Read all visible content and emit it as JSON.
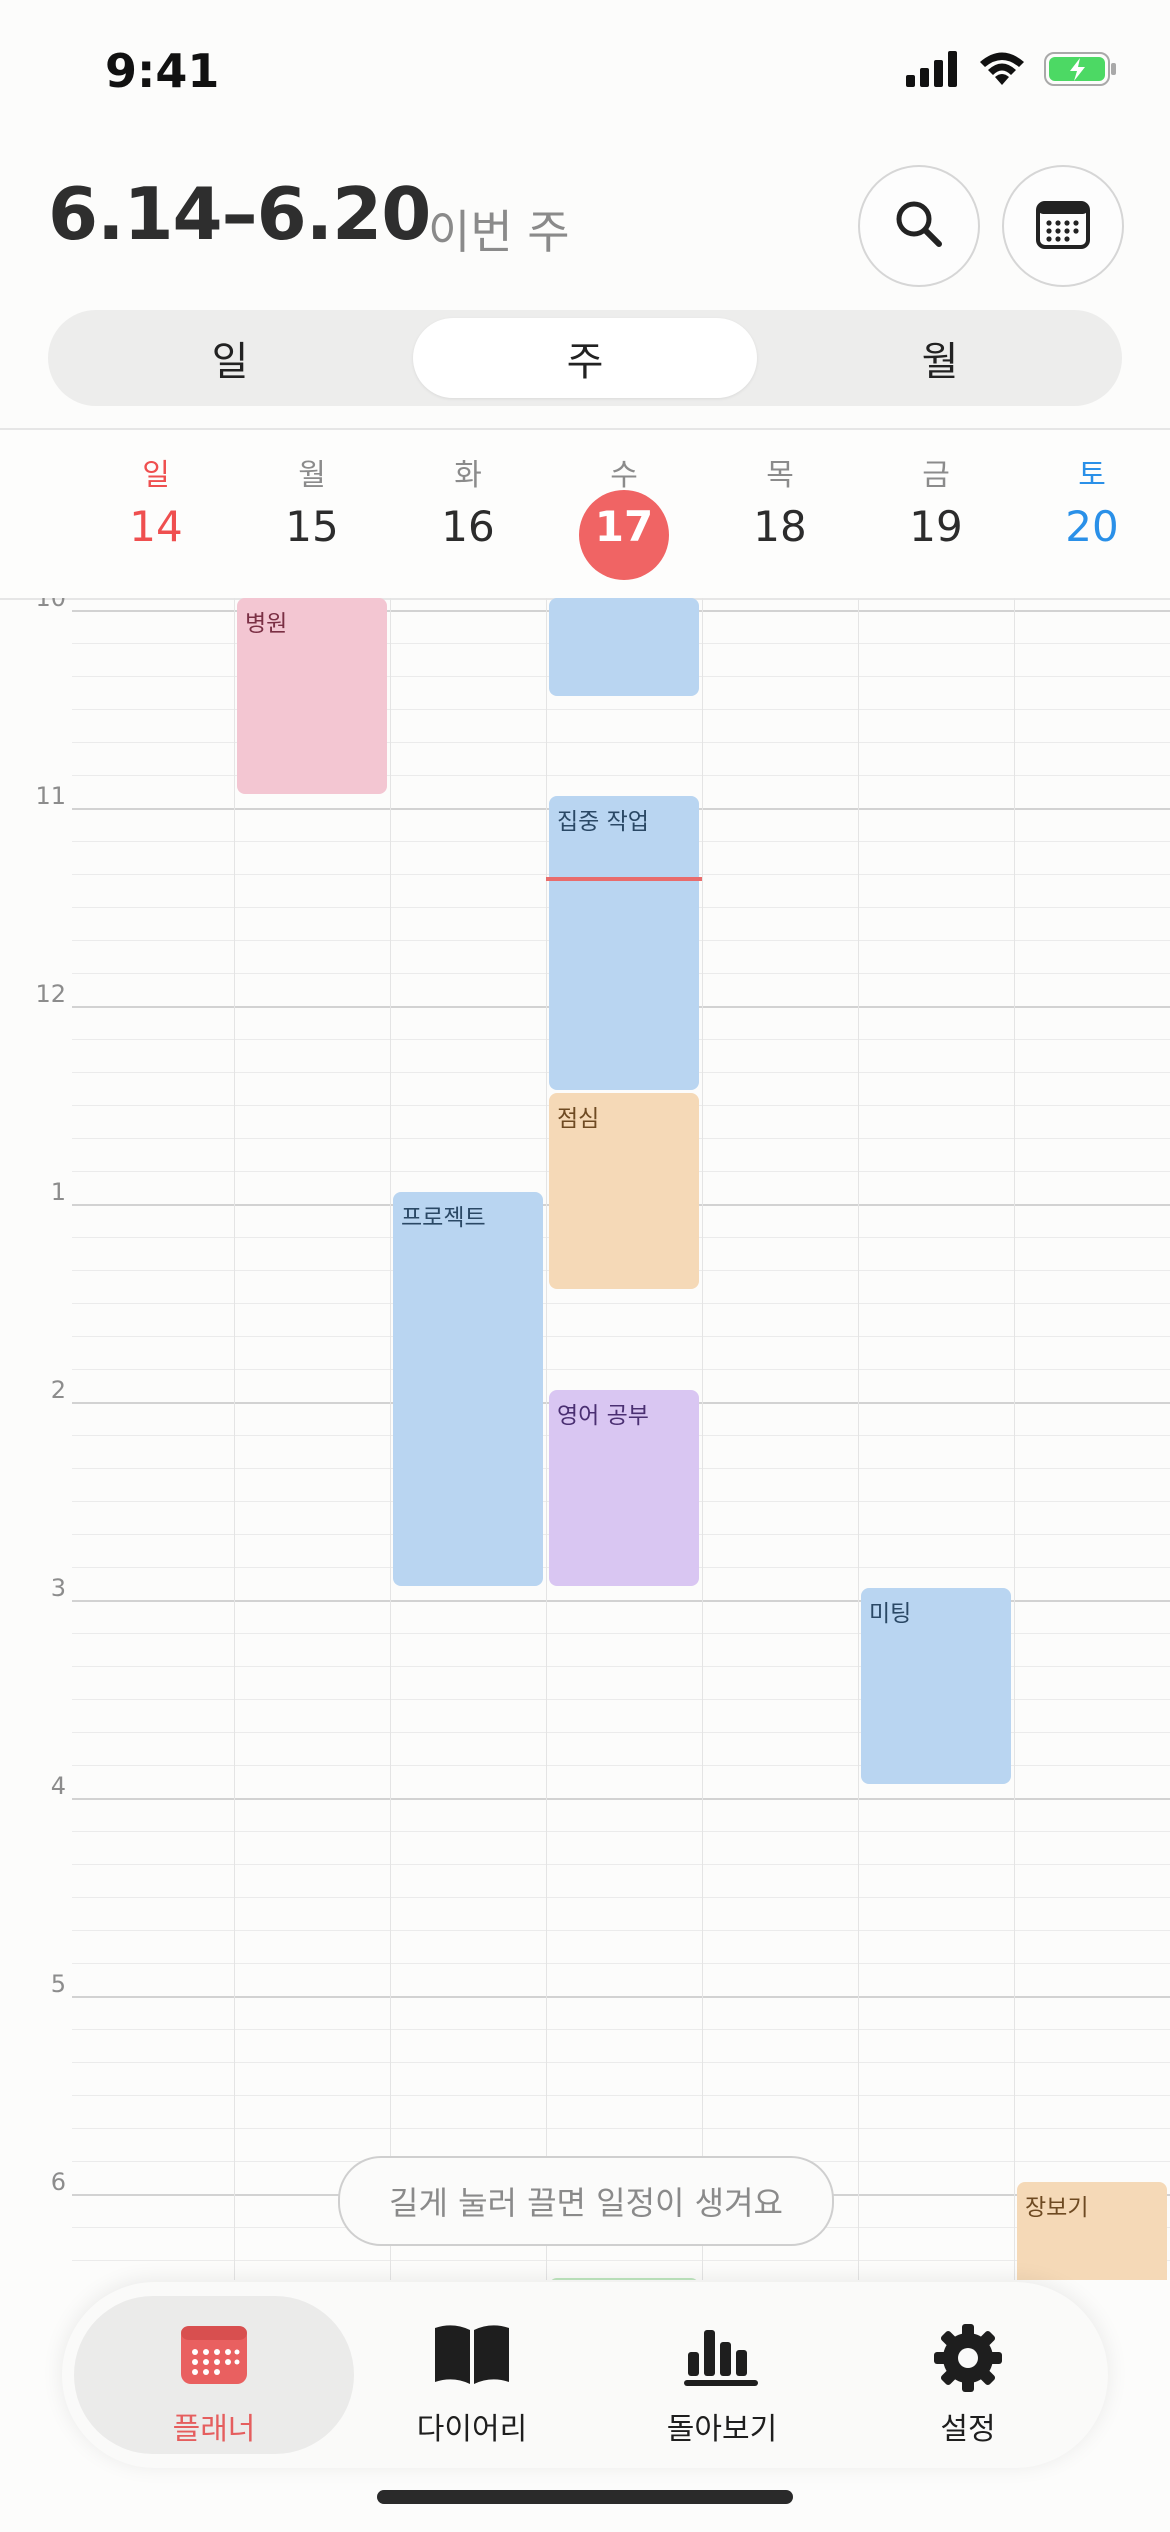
{
  "status_bar": {
    "time": "9:41"
  },
  "header": {
    "date_range": "6.14–6.20",
    "subtitle": "이번 주"
  },
  "segmented": {
    "day": "일",
    "week": "주",
    "month": "월",
    "selected": "주"
  },
  "week": {
    "days": [
      {
        "name": "일",
        "date": "14"
      },
      {
        "name": "월",
        "date": "15"
      },
      {
        "name": "화",
        "date": "16"
      },
      {
        "name": "수",
        "date": "17"
      },
      {
        "name": "목",
        "date": "18"
      },
      {
        "name": "금",
        "date": "19"
      },
      {
        "name": "토",
        "date": "20"
      }
    ],
    "today_index": 3
  },
  "timeline": {
    "hours": [
      "10",
      "11",
      "12",
      "1",
      "2",
      "3",
      "4",
      "5",
      "6"
    ],
    "events": [
      {
        "title": "병원",
        "day": "월",
        "start": "10:00",
        "end": "11:00",
        "color": "#f3c6d2"
      },
      {
        "title": "",
        "day": "수",
        "start": "10:00",
        "end": "10:30",
        "color": "#b9d5f1"
      },
      {
        "title": "집중 작업",
        "day": "수",
        "start": "11:00",
        "end": "12:30",
        "color": "#b9d5f1"
      },
      {
        "title": "점심",
        "day": "수",
        "start": "12:30",
        "end": "13:30",
        "color": "#f5d9b7"
      },
      {
        "title": "프로젝트",
        "day": "화",
        "start": "13:00",
        "end": "15:00",
        "color": "#b9d5f1"
      },
      {
        "title": "영어 공부",
        "day": "수",
        "start": "14:00",
        "end": "15:00",
        "color": "#d9c6f2"
      },
      {
        "title": "미팅",
        "day": "금",
        "start": "15:00",
        "end": "16:00",
        "color": "#b9d5f1"
      },
      {
        "title": "장보기",
        "day": "토",
        "start": "18:00",
        "end": "",
        "color": "#f5d9b7"
      }
    ],
    "current_time_color": "#e86c6c"
  },
  "hint": "길게 눌러 끌면 일정이 생겨요",
  "tabbar": {
    "items": [
      {
        "label": "플래너",
        "icon": "calendar-icon"
      },
      {
        "label": "다이어리",
        "icon": "book-icon"
      },
      {
        "label": "돌아보기",
        "icon": "bar-chart-icon"
      },
      {
        "label": "설정",
        "icon": "gear-icon"
      }
    ],
    "active": "플래너"
  },
  "colors": {
    "accent": "#f06464",
    "sunday": "#ef4f4f",
    "saturday": "#2a90e8"
  }
}
